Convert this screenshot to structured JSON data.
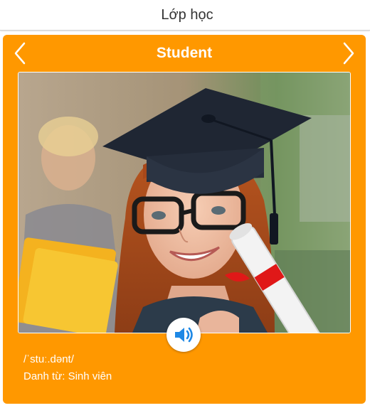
{
  "header": {
    "title": "Lớp học"
  },
  "flashcard": {
    "word": "Student",
    "phonetic": "/ˈstuː.dənt/",
    "meaning": "Danh từ: Sinh viên",
    "image_alt": "graduate-student-photo",
    "icons": {
      "prev": "chevron-left-icon",
      "next": "chevron-right-icon",
      "audio": "speaker-icon"
    }
  },
  "colors": {
    "card_background": "#ff9800",
    "accent_blue": "#1e88e5",
    "header_text": "#333333"
  }
}
